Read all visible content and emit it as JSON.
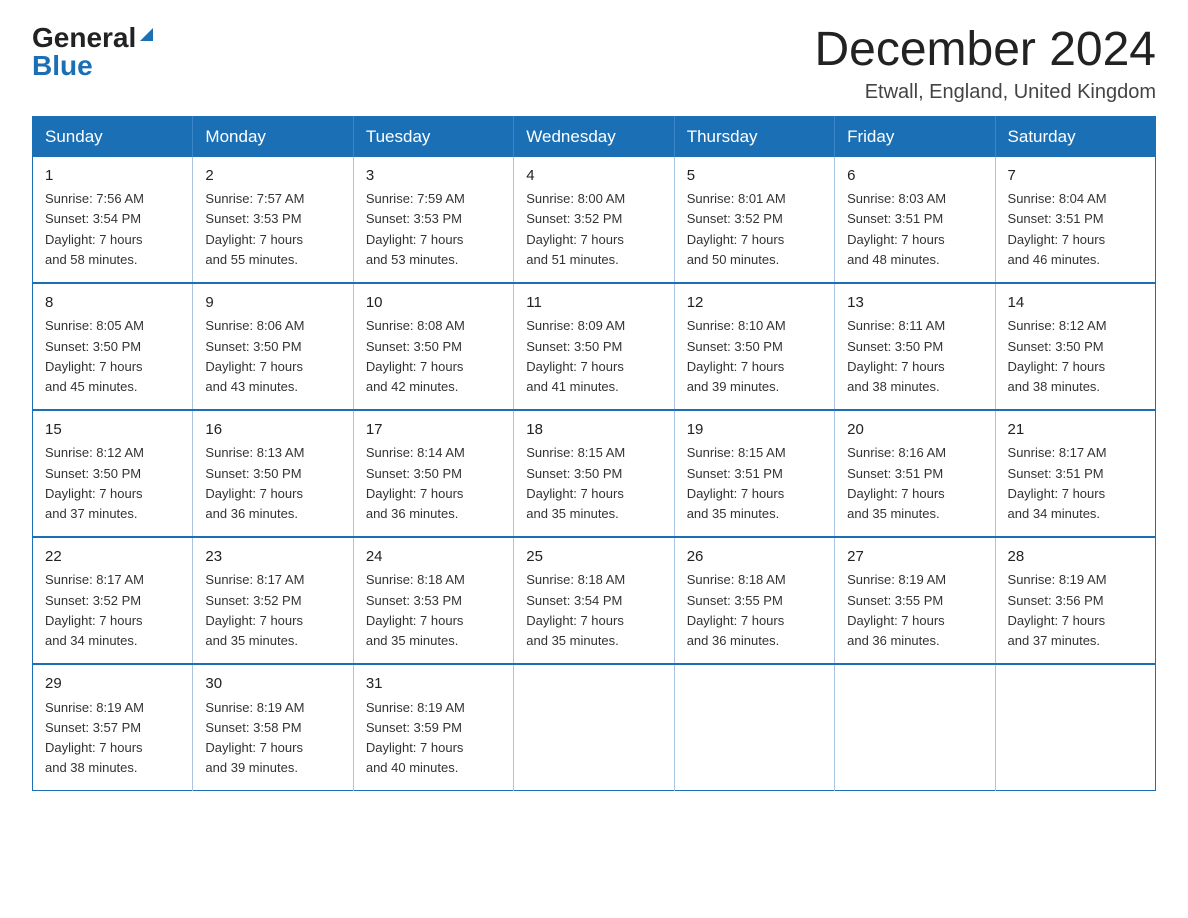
{
  "logo": {
    "general": "General",
    "blue": "Blue"
  },
  "title": {
    "month_year": "December 2024",
    "location": "Etwall, England, United Kingdom"
  },
  "headers": [
    "Sunday",
    "Monday",
    "Tuesday",
    "Wednesday",
    "Thursday",
    "Friday",
    "Saturday"
  ],
  "weeks": [
    [
      {
        "day": "1",
        "info": "Sunrise: 7:56 AM\nSunset: 3:54 PM\nDaylight: 7 hours\nand 58 minutes."
      },
      {
        "day": "2",
        "info": "Sunrise: 7:57 AM\nSunset: 3:53 PM\nDaylight: 7 hours\nand 55 minutes."
      },
      {
        "day": "3",
        "info": "Sunrise: 7:59 AM\nSunset: 3:53 PM\nDaylight: 7 hours\nand 53 minutes."
      },
      {
        "day": "4",
        "info": "Sunrise: 8:00 AM\nSunset: 3:52 PM\nDaylight: 7 hours\nand 51 minutes."
      },
      {
        "day": "5",
        "info": "Sunrise: 8:01 AM\nSunset: 3:52 PM\nDaylight: 7 hours\nand 50 minutes."
      },
      {
        "day": "6",
        "info": "Sunrise: 8:03 AM\nSunset: 3:51 PM\nDaylight: 7 hours\nand 48 minutes."
      },
      {
        "day": "7",
        "info": "Sunrise: 8:04 AM\nSunset: 3:51 PM\nDaylight: 7 hours\nand 46 minutes."
      }
    ],
    [
      {
        "day": "8",
        "info": "Sunrise: 8:05 AM\nSunset: 3:50 PM\nDaylight: 7 hours\nand 45 minutes."
      },
      {
        "day": "9",
        "info": "Sunrise: 8:06 AM\nSunset: 3:50 PM\nDaylight: 7 hours\nand 43 minutes."
      },
      {
        "day": "10",
        "info": "Sunrise: 8:08 AM\nSunset: 3:50 PM\nDaylight: 7 hours\nand 42 minutes."
      },
      {
        "day": "11",
        "info": "Sunrise: 8:09 AM\nSunset: 3:50 PM\nDaylight: 7 hours\nand 41 minutes."
      },
      {
        "day": "12",
        "info": "Sunrise: 8:10 AM\nSunset: 3:50 PM\nDaylight: 7 hours\nand 39 minutes."
      },
      {
        "day": "13",
        "info": "Sunrise: 8:11 AM\nSunset: 3:50 PM\nDaylight: 7 hours\nand 38 minutes."
      },
      {
        "day": "14",
        "info": "Sunrise: 8:12 AM\nSunset: 3:50 PM\nDaylight: 7 hours\nand 38 minutes."
      }
    ],
    [
      {
        "day": "15",
        "info": "Sunrise: 8:12 AM\nSunset: 3:50 PM\nDaylight: 7 hours\nand 37 minutes."
      },
      {
        "day": "16",
        "info": "Sunrise: 8:13 AM\nSunset: 3:50 PM\nDaylight: 7 hours\nand 36 minutes."
      },
      {
        "day": "17",
        "info": "Sunrise: 8:14 AM\nSunset: 3:50 PM\nDaylight: 7 hours\nand 36 minutes."
      },
      {
        "day": "18",
        "info": "Sunrise: 8:15 AM\nSunset: 3:50 PM\nDaylight: 7 hours\nand 35 minutes."
      },
      {
        "day": "19",
        "info": "Sunrise: 8:15 AM\nSunset: 3:51 PM\nDaylight: 7 hours\nand 35 minutes."
      },
      {
        "day": "20",
        "info": "Sunrise: 8:16 AM\nSunset: 3:51 PM\nDaylight: 7 hours\nand 35 minutes."
      },
      {
        "day": "21",
        "info": "Sunrise: 8:17 AM\nSunset: 3:51 PM\nDaylight: 7 hours\nand 34 minutes."
      }
    ],
    [
      {
        "day": "22",
        "info": "Sunrise: 8:17 AM\nSunset: 3:52 PM\nDaylight: 7 hours\nand 34 minutes."
      },
      {
        "day": "23",
        "info": "Sunrise: 8:17 AM\nSunset: 3:52 PM\nDaylight: 7 hours\nand 35 minutes."
      },
      {
        "day": "24",
        "info": "Sunrise: 8:18 AM\nSunset: 3:53 PM\nDaylight: 7 hours\nand 35 minutes."
      },
      {
        "day": "25",
        "info": "Sunrise: 8:18 AM\nSunset: 3:54 PM\nDaylight: 7 hours\nand 35 minutes."
      },
      {
        "day": "26",
        "info": "Sunrise: 8:18 AM\nSunset: 3:55 PM\nDaylight: 7 hours\nand 36 minutes."
      },
      {
        "day": "27",
        "info": "Sunrise: 8:19 AM\nSunset: 3:55 PM\nDaylight: 7 hours\nand 36 minutes."
      },
      {
        "day": "28",
        "info": "Sunrise: 8:19 AM\nSunset: 3:56 PM\nDaylight: 7 hours\nand 37 minutes."
      }
    ],
    [
      {
        "day": "29",
        "info": "Sunrise: 8:19 AM\nSunset: 3:57 PM\nDaylight: 7 hours\nand 38 minutes."
      },
      {
        "day": "30",
        "info": "Sunrise: 8:19 AM\nSunset: 3:58 PM\nDaylight: 7 hours\nand 39 minutes."
      },
      {
        "day": "31",
        "info": "Sunrise: 8:19 AM\nSunset: 3:59 PM\nDaylight: 7 hours\nand 40 minutes."
      },
      {
        "day": "",
        "info": ""
      },
      {
        "day": "",
        "info": ""
      },
      {
        "day": "",
        "info": ""
      },
      {
        "day": "",
        "info": ""
      }
    ]
  ]
}
